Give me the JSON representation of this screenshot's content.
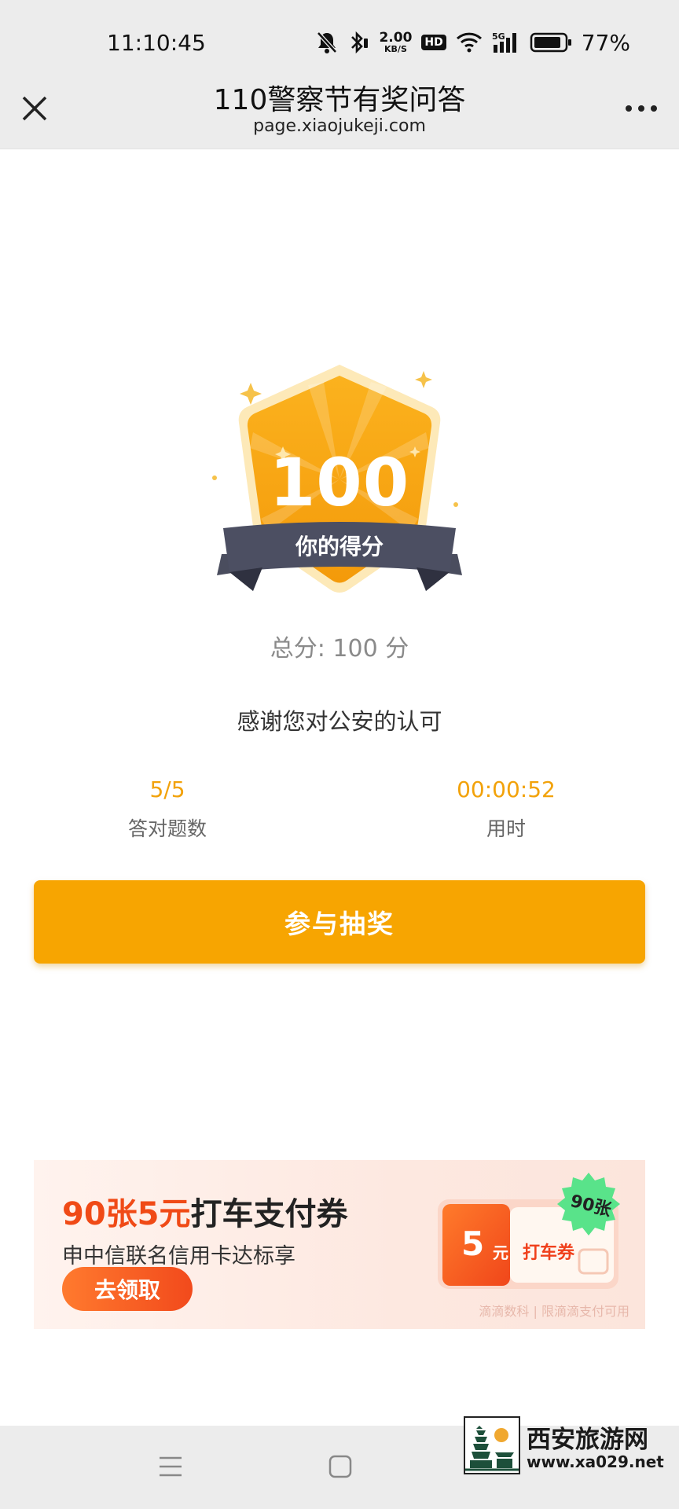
{
  "status_bar": {
    "time": "11:10:45",
    "net_speed_value": "2.00",
    "net_speed_unit": "KB/S",
    "hd": "HD",
    "battery": "77%"
  },
  "title_bar": {
    "title": "110警察节有奖问答",
    "domain": "page.xiaojukeji.com"
  },
  "result": {
    "score": "100",
    "score_label": "你的得分",
    "total": "总分: 100 分",
    "thanks": "感谢您对公安的认可"
  },
  "stats": {
    "correct_value": "5/5",
    "correct_label": "答对题数",
    "time_value": "00:00:52",
    "time_label": "用时"
  },
  "actions": {
    "draw_label": "参与抽奖"
  },
  "ad": {
    "title_highlight": "90张5元",
    "title_rest": "打车支付券",
    "subtitle": "申中信联名信用卡达标享",
    "cta": "去领取",
    "coupon_amount": "5",
    "coupon_unit": "元",
    "coupon_label": "打车券",
    "coupon_burst": "90张",
    "footnote": "滴滴数科 | 限滴滴支付可用"
  },
  "watermark": {
    "name": "西安旅游网",
    "url": "www.xa029.net"
  },
  "colors": {
    "accent": "#f7a501",
    "stat_value": "#f2a20a",
    "ad_highlight": "#f04a16"
  }
}
